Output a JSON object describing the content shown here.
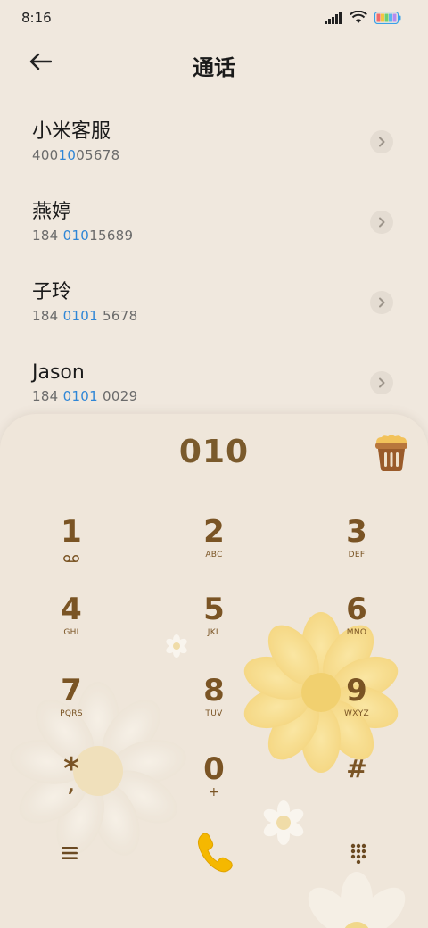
{
  "status_bar": {
    "time": "8:16"
  },
  "header": {
    "title": "通话"
  },
  "contacts": [
    {
      "name": "小米客服",
      "number_pre": "400",
      "number_hl": "10",
      "number_post": "05678",
      "number_mid": "1",
      "number_mid2": "0"
    },
    {
      "name": "燕婷",
      "number_pre": "184 ",
      "number_hl": "010",
      "number_post": "15689"
    },
    {
      "name": "子玲",
      "number_pre": "184 ",
      "number_hl": "0101",
      "number_post": " 5678"
    },
    {
      "name": "Jason",
      "number_pre": "184 ",
      "number_hl": "0101",
      "number_post": " 0029"
    }
  ],
  "dialer": {
    "input_value": "010",
    "keys": [
      {
        "digit": "1",
        "letters": ""
      },
      {
        "digit": "2",
        "letters": "ABC"
      },
      {
        "digit": "3",
        "letters": "DEF"
      },
      {
        "digit": "4",
        "letters": "GHI"
      },
      {
        "digit": "5",
        "letters": "JKL"
      },
      {
        "digit": "6",
        "letters": "MNO"
      },
      {
        "digit": "7",
        "letters": "PQRS"
      },
      {
        "digit": "8",
        "letters": "TUV"
      },
      {
        "digit": "9",
        "letters": "WXYZ"
      },
      {
        "digit": "*",
        "letters": ","
      },
      {
        "digit": "0",
        "letters": "+"
      },
      {
        "digit": "#",
        "letters": ""
      }
    ]
  },
  "icons": {
    "back": "back-arrow-icon",
    "detail": "chevron-right-icon",
    "delete": "trash-bin-icon",
    "voicemail": "voicemail-icon",
    "menu": "menu-icon",
    "call": "phone-call-icon",
    "keypad": "keypad-icon"
  },
  "colors": {
    "background": "#f0e8de",
    "accent_brown": "#7a5424",
    "highlight_blue": "#2f86d6",
    "call_yellow": "#f5b800"
  }
}
